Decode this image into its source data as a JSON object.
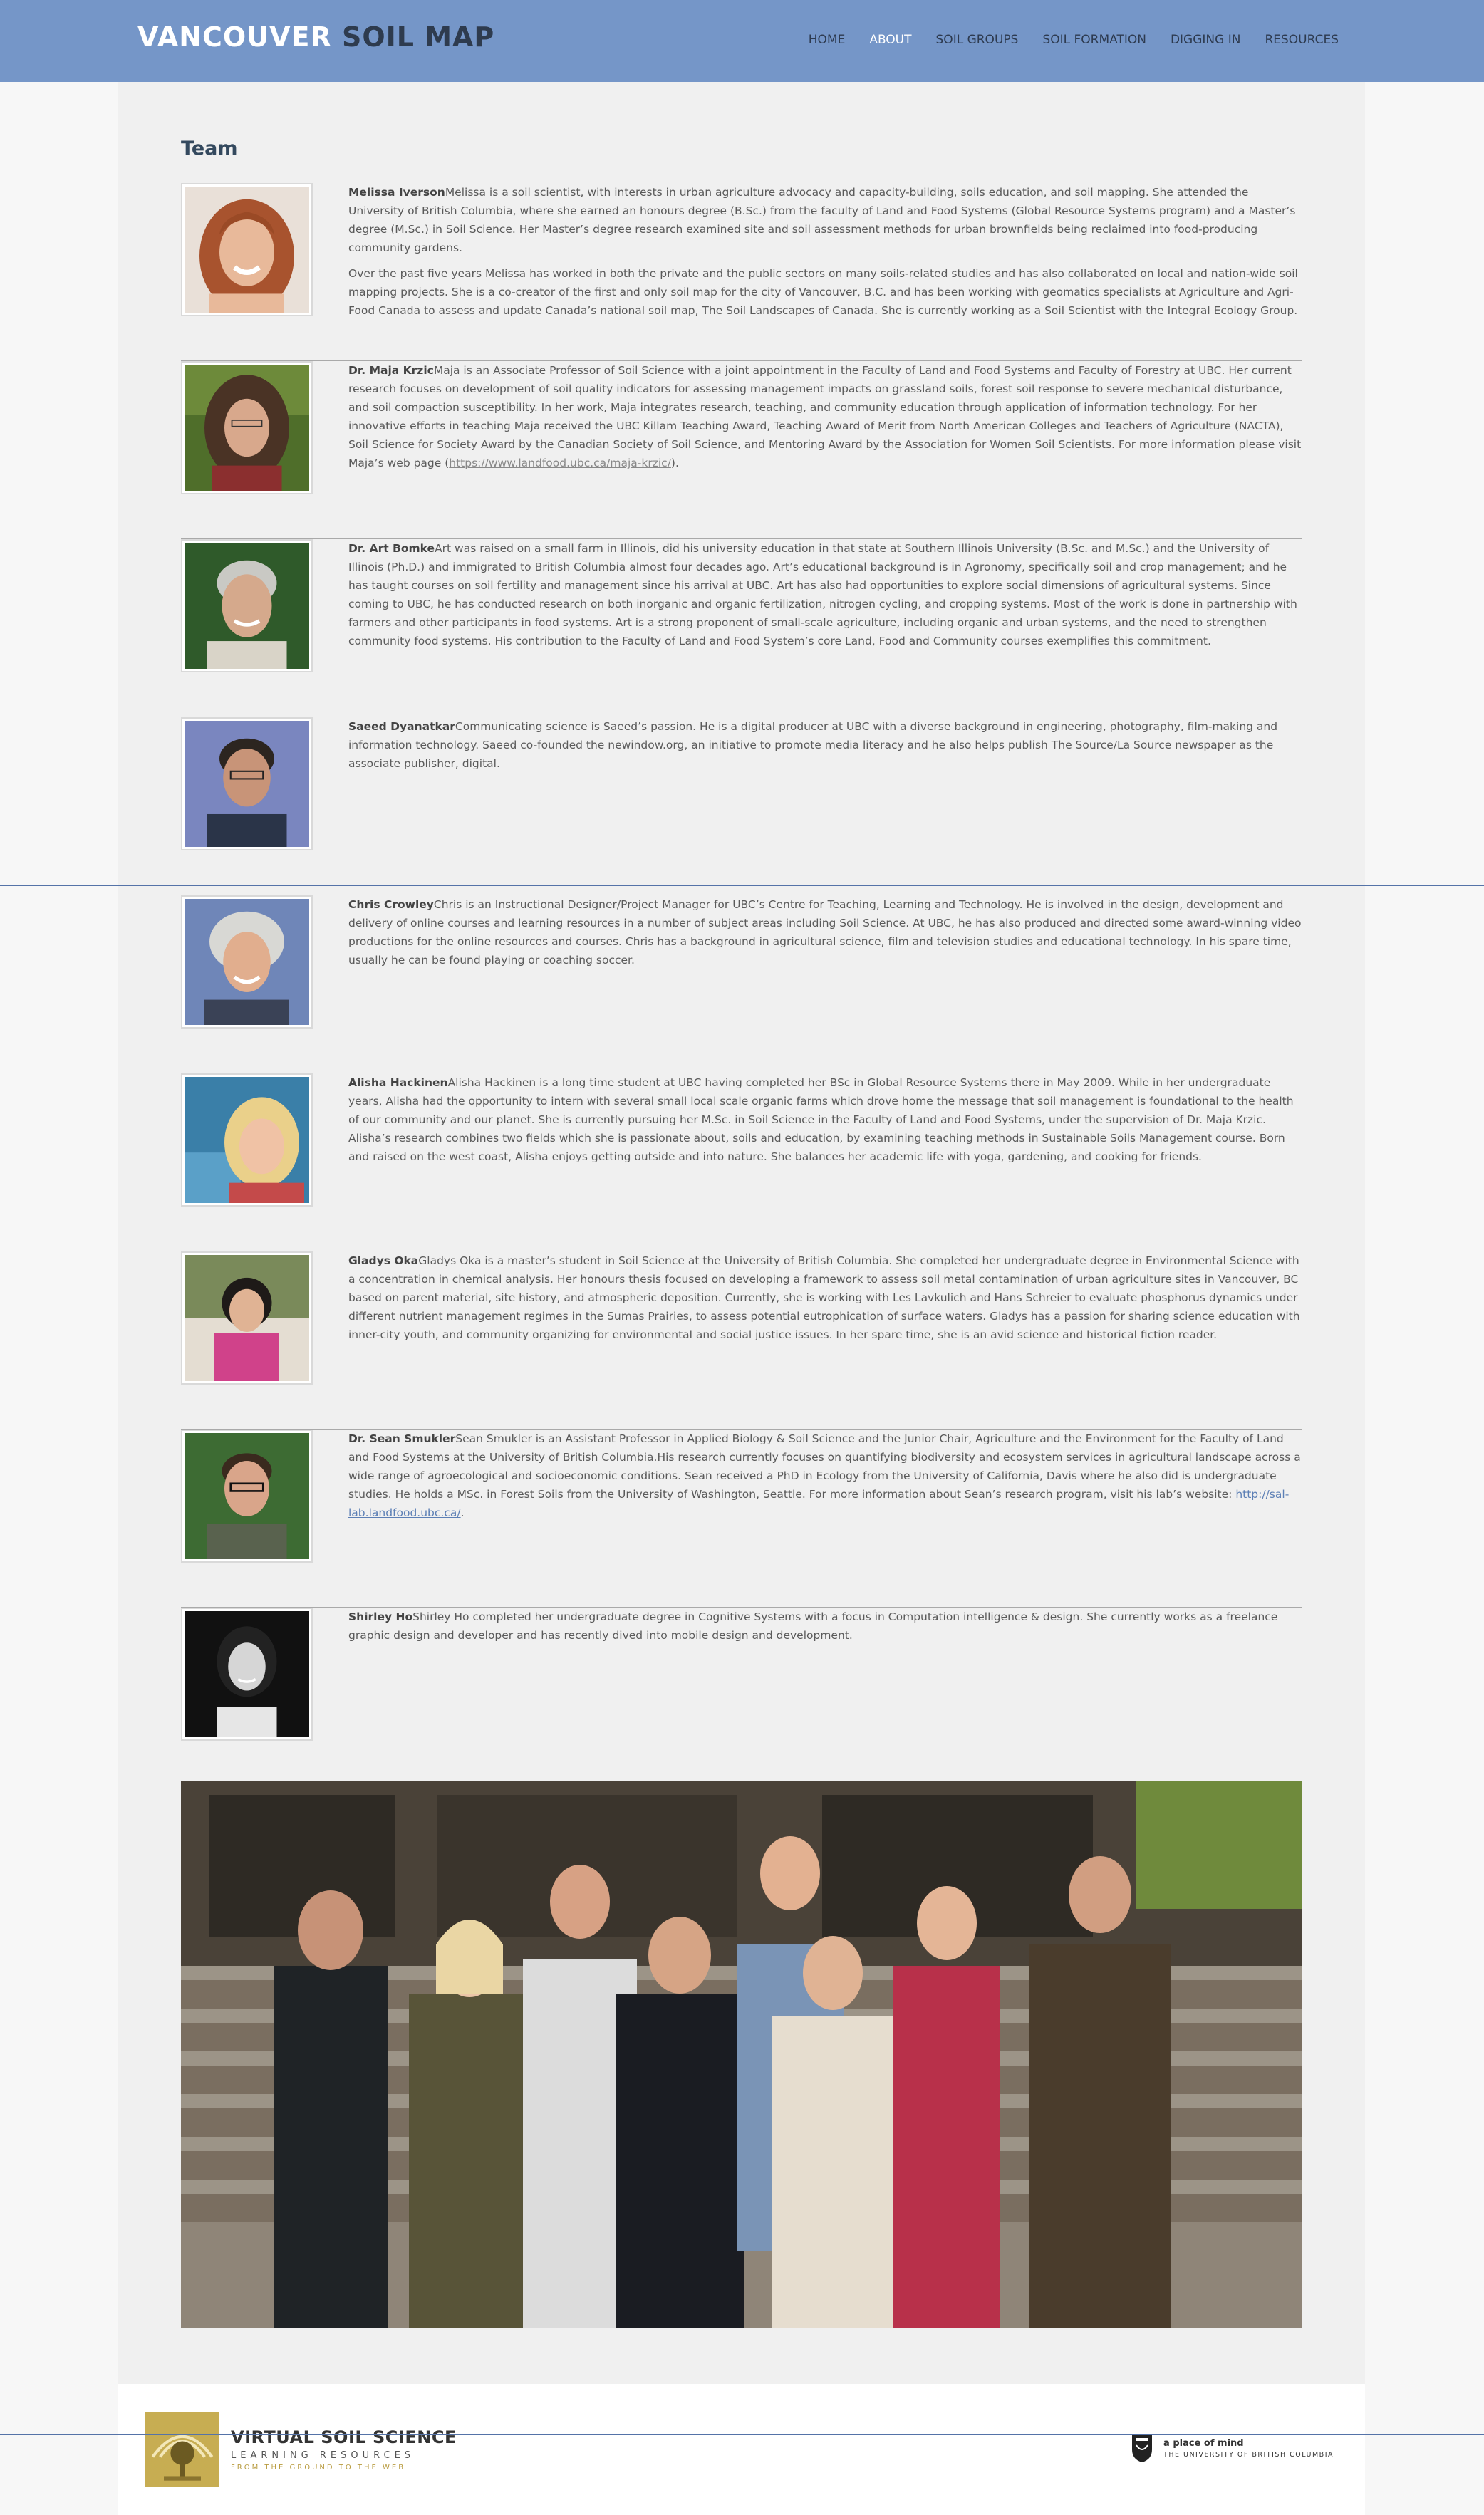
{
  "header": {
    "logo_part1": "VANCOUVER",
    "logo_part2": "SOIL MAP",
    "nav": [
      {
        "label": "HOME",
        "active": false
      },
      {
        "label": "ABOUT",
        "active": true
      },
      {
        "label": "SOIL GROUPS",
        "active": false
      },
      {
        "label": "SOIL FORMATION",
        "active": false
      },
      {
        "label": "DIGGING IN",
        "active": false
      },
      {
        "label": "RESOURCES",
        "active": false
      }
    ]
  },
  "page": {
    "title": "Team"
  },
  "members": [
    {
      "name": "Melissa Iverson",
      "bio": "Melissa is a soil scientist, with interests in urban agriculture advocacy and capacity-building, soils education, and soil mapping. She attended the University of British Columbia, where she earned an honours degree (B.Sc.) from the faculty of Land and Food Systems (Global Resource Systems program) and a Master’s degree (M.Sc.) in Soil Science. Her Master’s degree research examined site and soil assessment methods for urban brownfields being reclaimed into food-producing community gardens.",
      "bio2": "Over the past five years Melissa has worked in both the private and the public sectors on many soils-related studies and has also collaborated on local and nation-wide soil mapping projects. She is a co-creator of the first and only soil map for the city of Vancouver, B.C. and has been working with geomatics specialists at Agriculture and Agri-Food Canada to assess and update Canada’s national soil map, The Soil Landscapes of Canada. She is currently working as a Soil Scientist with the Integral Ecology Group."
    },
    {
      "name": "Dr. Maja Krzic",
      "bio": "Maja is an Associate Professor of Soil Science with a joint appointment in the Faculty of Land and Food Systems and Faculty of Forestry at UBC. Her current research focuses on development of soil quality indicators for assessing management impacts on grassland soils, forest soil response to severe mechanical disturbance, and soil compaction susceptibility. In her work, Maja integrates research, teaching, and community education through application of information technology. For her innovative efforts in teaching Maja received the UBC Killam Teaching Award, Teaching Award of Merit from North American Colleges and Teachers of Agriculture (NACTA), Soil Science for Society Award by the Canadian Society of Soil Science, and Mentoring Award by the Association for Women Soil Scientists. For more information please visit Maja’s web page (",
      "link": "https://www.landfood.ubc.ca/maja-krzic/",
      "bio_end": ")."
    },
    {
      "name": "Dr. Art Bomke",
      "bio": "Art was raised on a small farm in Illinois, did his university education in that state at Southern Illinois University (B.Sc. and M.Sc.) and the University of Illinois (Ph.D.) and immigrated to British Columbia almost four decades ago. Art’s educational background is in Agronomy, specifically soil and crop management; and he has taught courses on soil fertility and management since his arrival at UBC. Art has also had opportunities to explore social dimensions of agricultural systems. Since coming to UBC, he has conducted research on both inorganic and organic fertilization, nitrogen cycling, and cropping systems. Most of the work is done in partnership with farmers and other participants in food systems. Art is a strong proponent of small-scale agriculture, including organic and urban systems, and the need to strengthen community food systems. His contribution to the Faculty of Land and Food System’s core Land, Food and Community courses exemplifies this commitment."
    },
    {
      "name": "Saeed Dyanatkar",
      "bio": "Communicating science is Saeed’s passion. He is a digital producer at UBC with a diverse background in engineering, photography, film-making and information technology. Saeed co-founded the newindow.org, an initiative to promote media literacy and he also helps publish The Source/La Source newspaper as the associate publisher, digital."
    },
    {
      "name": "Chris Crowley",
      "bio": "Chris is an Instructional Designer/Project Manager for UBC’s Centre for Teaching, Learning and Technology. He is involved in the design, development and delivery of online courses and learning resources in a number of subject areas including Soil Science. At UBC, he has also produced and directed some award-winning video productions for the online resources and courses. Chris has a background in agricultural science, film and television studies and educational technology. In his spare time, usually he can be found playing or coaching soccer."
    },
    {
      "name": "Alisha Hackinen",
      "bio": "Alisha Hackinen is a long time student at UBC having completed her BSc in Global Resource Systems there in May 2009. While in her undergraduate years, Alisha had the opportunity to intern with several small local scale organic farms which drove home the message that soil management is foundational to the health of our community and our planet. She is currently pursuing her M.Sc. in Soil Science in the Faculty of Land and Food Systems, under the supervision of Dr. Maja Krzic. Alisha’s research combines two fields which she is passionate about, soils and education, by examining teaching methods in Sustainable Soils Management course. Born and raised on the west coast, Alisha enjoys getting outside and into nature. She balances her academic life with yoga, gardening, and cooking for friends."
    },
    {
      "name": "Gladys Oka",
      "bio": "Gladys Oka is a master’s student in Soil Science at the University of British Columbia. She completed her undergraduate degree in Environmental Science with a concentration in chemical analysis. Her honours thesis focused on developing a framework to assess soil metal contamination of urban agriculture sites in Vancouver, BC based on parent material, site history, and atmospheric deposition. Currently, she is working with Les Lavkulich and Hans Schreier to evaluate phosphorus dynamics under different nutrient management regimes in the Sumas Prairies, to assess potential eutrophication of surface waters. Gladys has a passion for sharing science education with inner-city youth, and community organizing for environmental and social justice issues. In her spare time, she is an avid science and historical fiction reader."
    },
    {
      "name": "Dr. Sean Smukler",
      "bio": "Sean Smukler is an Assistant Professor in Applied Biology & Soil Science and the Junior Chair, Agriculture and the Environment for the Faculty of Land and Food Systems at the University of British Columbia.His research currently focuses on quantifying biodiversity and ecosystem services in agricultural landscape across a wide range of agroecological and socioeconomic conditions. Sean received a PhD in Ecology from the University of California, Davis where he also did is undergraduate studies. He holds a MSc. in Forest Soils from the University of Washington, Seattle. For more information about Sean’s research program, visit his lab’s website: ",
      "link": "http://sal-lab.landfood.ubc.ca/",
      "bio_end": "."
    },
    {
      "name": "Shirley Ho",
      "bio": "Shirley Ho completed her undergraduate degree in Cognitive Systems with a focus in Computation intelligence & design. She currently works as a freelance graphic design and developer and has recently dived into mobile design and development."
    }
  ],
  "footer": {
    "vss_title": "VIRTUAL SOIL SCIENCE",
    "vss_sub": "LEARNING RESOURCES",
    "vss_tag": "FROM THE GROUND TO THE WEB",
    "ubc_title": "a place of mind",
    "ubc_sub": "THE UNIVERSITY OF BRITISH COLUMBIA"
  },
  "colors": {
    "header_bg": "#7596c8",
    "logo_dark": "#2e3b4e",
    "nav_text": "#2d3a4f",
    "link_blue": "#5c7fb5"
  }
}
